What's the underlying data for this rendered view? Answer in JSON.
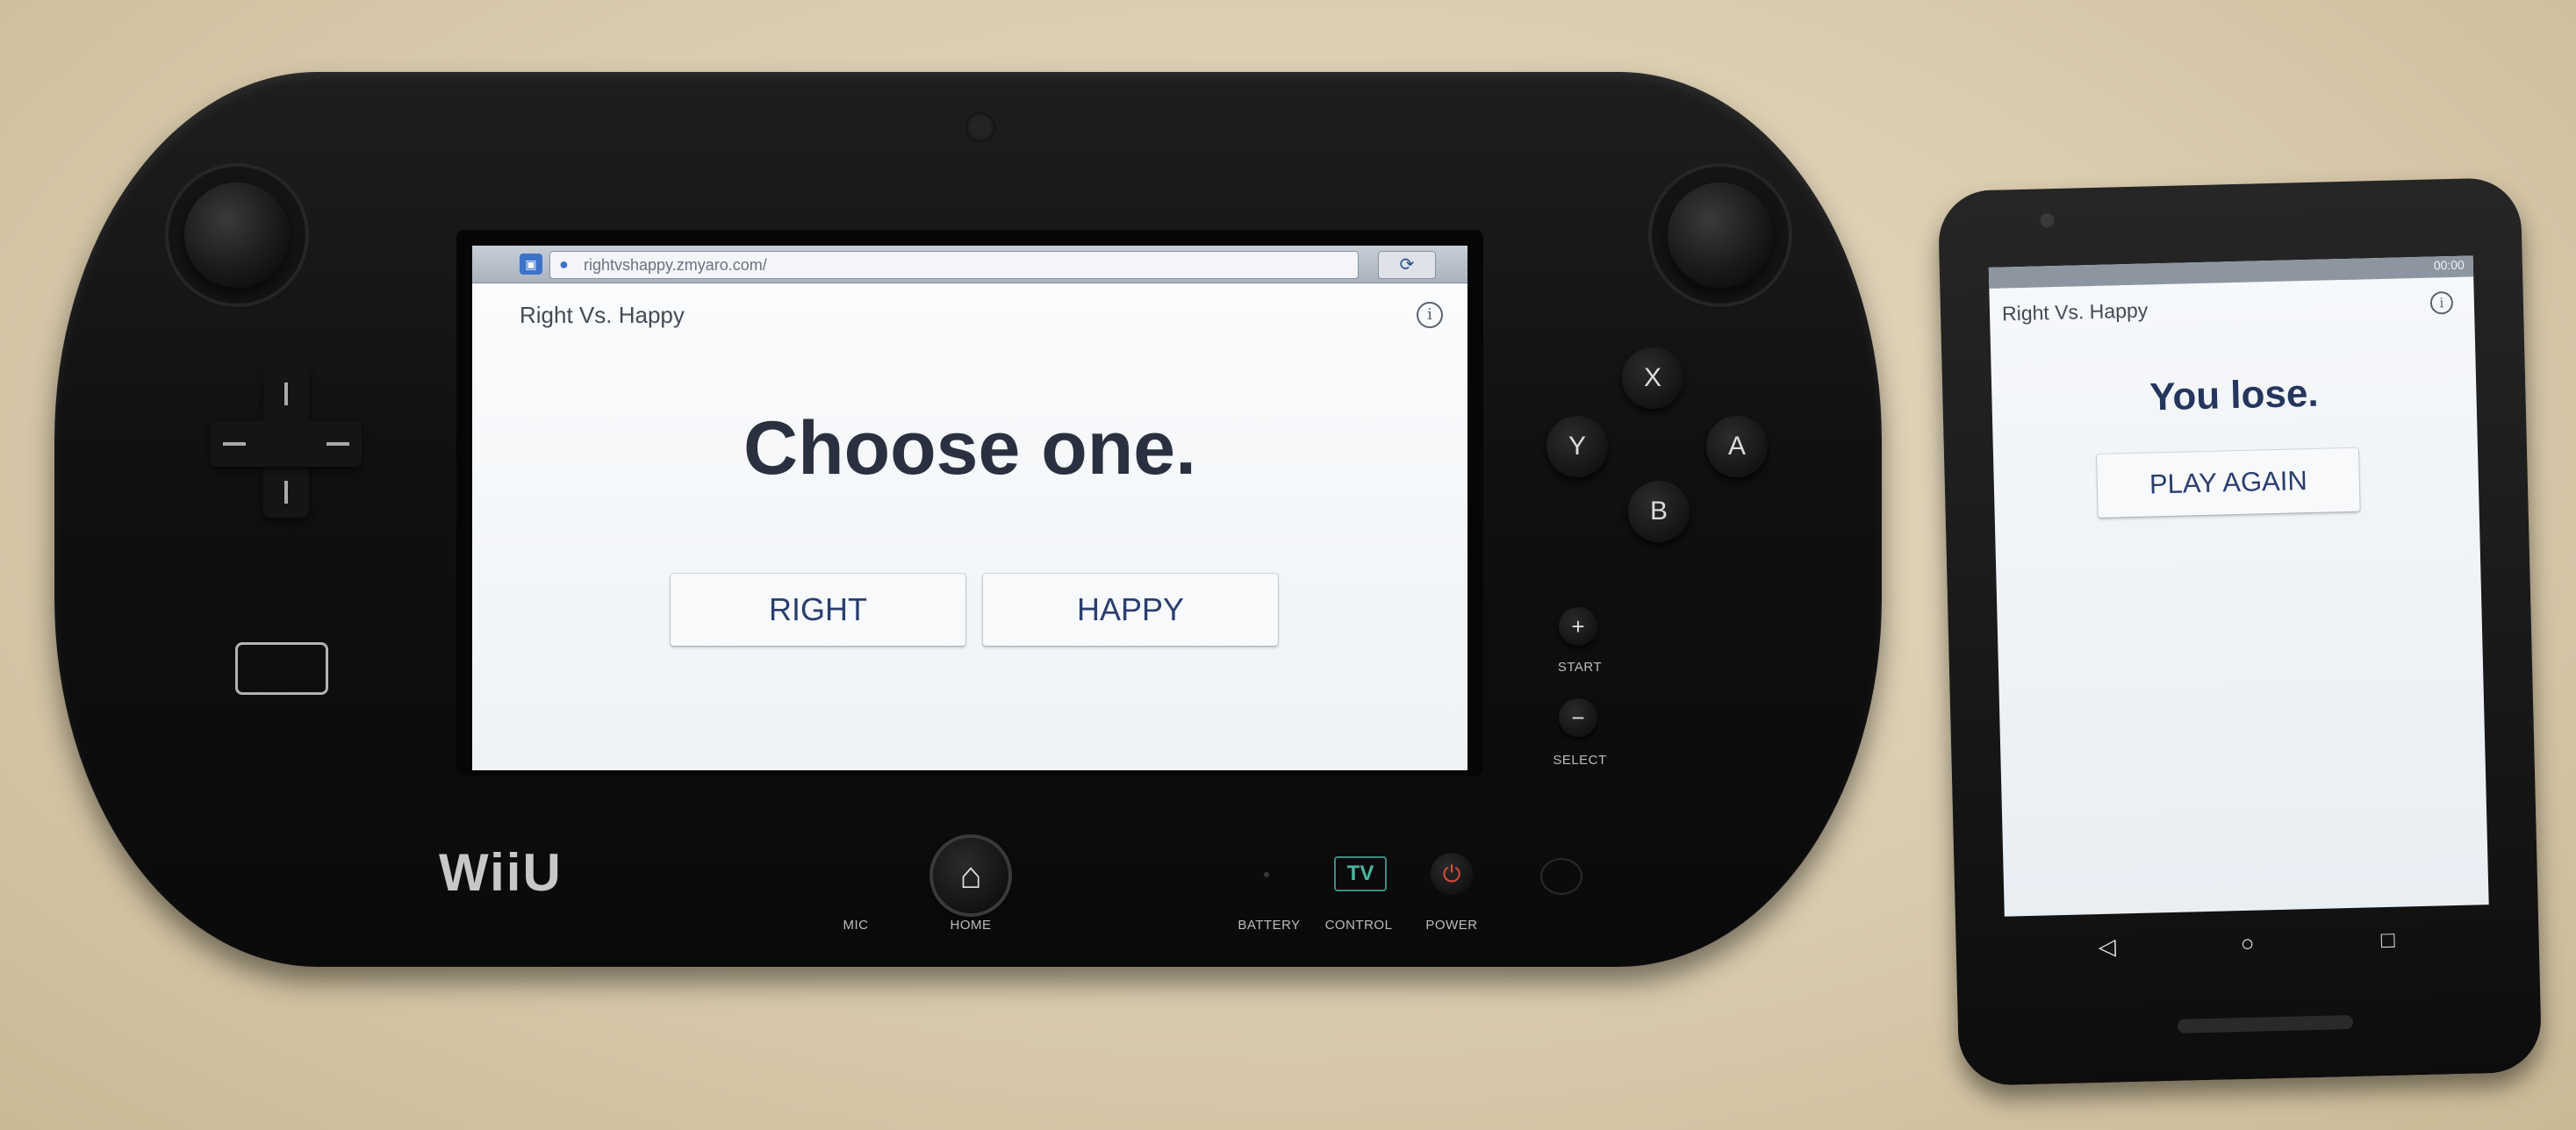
{
  "gamepad": {
    "brand_logo": "WiiU",
    "buttons": {
      "x": "X",
      "y": "Y",
      "a": "A",
      "b": "B",
      "plus": "+",
      "minus": "−"
    },
    "labels": {
      "start": "START",
      "select": "SELECT",
      "mic": "MIC",
      "home": "HOME",
      "battery": "BATTERY",
      "control": "CONTROL",
      "power": "POWER",
      "tv": "TV"
    },
    "screen": {
      "url": "rightvshappy.zmyaro.com/",
      "app_title": "Right Vs. Happy",
      "info_symbol": "i",
      "headline": "Choose one.",
      "choices": [
        "RIGHT",
        "HAPPY"
      ]
    }
  },
  "phone": {
    "screen": {
      "app_title": "Right Vs. Happy",
      "info_symbol": "i",
      "status_time": "00:00",
      "headline": "You lose.",
      "button": "PLAY AGAIN"
    }
  },
  "icons": [
    "camera-icon",
    "home-icon",
    "power-icon",
    "reload-icon",
    "globe-icon",
    "info-icon",
    "back-icon",
    "home-circle-icon",
    "recents-icon"
  ]
}
